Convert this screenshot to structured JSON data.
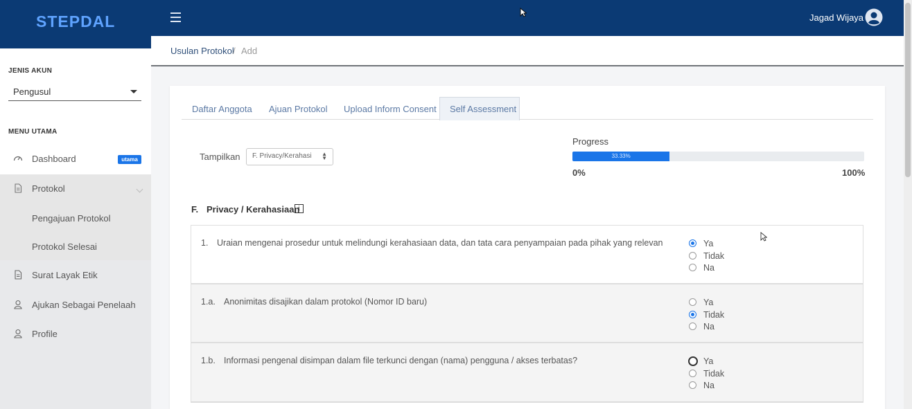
{
  "app": {
    "brand": "STEPDAL"
  },
  "topbar": {
    "user_name": "Jagad Wijaya",
    "menu_icon": "hamburger-icon",
    "avatar_icon": "user-circle-icon"
  },
  "sidebar": {
    "account_label": "JENIS AKUN",
    "account_value": "Pengusul",
    "menu_label": "MENU UTAMA",
    "dashboard": {
      "label": "Dashboard",
      "badge": "utama"
    },
    "protokol": {
      "label": "Protokol",
      "subitems": [
        "Pengajuan Protokol",
        "Protokol Selesai"
      ]
    },
    "items": [
      "Surat Layak Etik",
      "Ajukan Sebagai Penelaah",
      "Profile"
    ]
  },
  "breadcrumb": {
    "parent": "Usulan Protokol",
    "separator": "/",
    "current": "Add"
  },
  "tabs": [
    "Daftar Anggota",
    "Ajuan Protokol",
    "Upload Inform Consent",
    "Self Assessment"
  ],
  "active_tab": "Self Assessment",
  "filter": {
    "label": "Tampilkan",
    "value": "F. Privacy/Kerahasi"
  },
  "progress": {
    "label": "Progress",
    "value": 0.3333,
    "text": "33.33%",
    "min_label": "0%",
    "max_label": "100%"
  },
  "section": {
    "letter": "F.",
    "title": "Privacy / Kerahasiaan",
    "info_icon": "i"
  },
  "options": [
    "Ya",
    "Tidak",
    "Na"
  ],
  "questions": [
    {
      "num": "1.",
      "text": "Uraian mengenai prosedur untuk melindungi kerahasiaan data, dan tata cara penyampaian pada pihak yang relevan",
      "selected": "Ya"
    },
    {
      "num": "1.a.",
      "text": "Anonimitas disajikan dalam protokol (Nomor ID baru)",
      "selected": "Tidak"
    },
    {
      "num": "1.b.",
      "text": "Informasi pengenal disimpan dalam file terkunci dengan (nama) pengguna / akses terbatas?",
      "selected": ""
    }
  ],
  "colors": {
    "primary": "#0b3a74",
    "accent": "#1a75e8",
    "brand_text": "#5fa3ff"
  }
}
